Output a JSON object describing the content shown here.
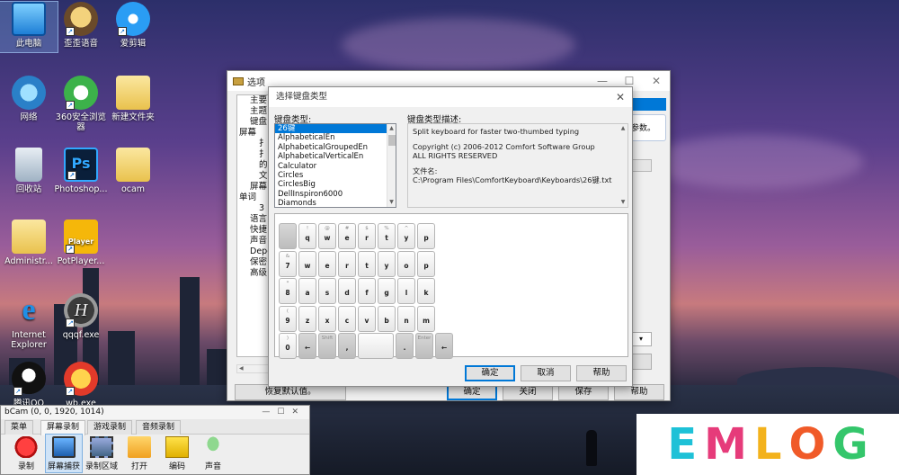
{
  "desktop": {
    "icons": [
      {
        "label": "此电脑"
      },
      {
        "label": "歪歪语音"
      },
      {
        "label": "爱剪辑"
      },
      {
        "label": "网络"
      },
      {
        "label": "360安全浏览器"
      },
      {
        "label": "新建文件夹"
      },
      {
        "label": "回收站"
      },
      {
        "label": "Photoshop..."
      },
      {
        "label": "ocam"
      },
      {
        "label": "Administr..."
      },
      {
        "label": "PotPlayer..."
      },
      {
        "label": "Internet Explorer"
      },
      {
        "label": "qqqf.exe"
      },
      {
        "label": "腾讯QQ"
      },
      {
        "label": "wb.exe"
      }
    ]
  },
  "options_window": {
    "title": "选项",
    "tree_items": [
      "主要",
      "主题",
      "键盘",
      "屏幕",
      "扌",
      "扌",
      "的",
      "文",
      "屏幕",
      "单词",
      "3",
      "语言",
      "快捷",
      "声音",
      "Depe",
      "保密",
      "高级"
    ],
    "right_text": "参数。",
    "buttons": {
      "reset": "恢复默认值。",
      "ok": "确定",
      "close": "关闭",
      "save": "保存",
      "help": "帮助"
    }
  },
  "keyboard_dialog": {
    "title": "选择键盘类型",
    "list_label": "键盘类型:",
    "list_items": [
      "26键",
      "AlphabeticalEn",
      "AlphabeticalGroupedEn",
      "AlphabeticalVerticalEn",
      "Calculator",
      "Circles",
      "CirclesBig",
      "DellInspiron6000",
      "Diamonds"
    ],
    "selected_index": 0,
    "desc_label": "键盘类型描述:",
    "desc_lines": [
      "Split keyboard for faster two-thumbed typing",
      "",
      "Copyright (c) 2006-2012  Comfort Software Group",
      "ALL RIGHTS RESERVED",
      "",
      "文件名:",
      "C:\\Program Files\\ComfortKeyboard\\Keyboards\\26键.txt"
    ],
    "buttons": {
      "ok": "确定",
      "cancel": "取消",
      "help": "帮助"
    },
    "keys": [
      [
        {
          "s": "",
          "m": "",
          "g": true
        },
        {
          "s": "!",
          "m": "q"
        },
        {
          "s": "@",
          "m": "w"
        },
        {
          "s": "#",
          "m": "e"
        },
        {
          "s": "$",
          "m": "r"
        },
        {
          "s": "%",
          "m": "t"
        },
        {
          "s": "^",
          "m": "y"
        },
        {
          "s": "",
          "m": "p"
        }
      ],
      [
        {
          "s": "&",
          "m": "7"
        },
        {
          "s": "",
          "m": "w"
        },
        {
          "s": "",
          "m": "e"
        },
        {
          "s": "",
          "m": "r"
        },
        {
          "s": "",
          "m": "t"
        },
        {
          "s": "",
          "m": "y"
        },
        {
          "s": "",
          "m": "o"
        },
        {
          "s": "",
          "m": "p"
        }
      ],
      [
        {
          "s": "*",
          "m": "8"
        },
        {
          "s": "",
          "m": "a"
        },
        {
          "s": "",
          "m": "s"
        },
        {
          "s": "",
          "m": "d"
        },
        {
          "s": "",
          "m": "f"
        },
        {
          "s": "",
          "m": "g"
        },
        {
          "s": "",
          "m": "l"
        },
        {
          "s": "",
          "m": "k"
        }
      ],
      [
        {
          "s": "(",
          "m": "9"
        },
        {
          "s": "",
          "m": "z"
        },
        {
          "s": "",
          "m": "x"
        },
        {
          "s": "",
          "m": "c"
        },
        {
          "s": "",
          "m": "v"
        },
        {
          "s": "",
          "m": "b"
        },
        {
          "s": "",
          "m": "n"
        },
        {
          "s": "",
          "m": "m"
        }
      ],
      [
        {
          "s": ")",
          "m": "0"
        },
        {
          "s": "",
          "m": "←",
          "g": true
        },
        {
          "s": "Shift",
          "m": "",
          "g": true
        },
        {
          "s": "",
          "m": ",",
          "g": true
        },
        {
          "s": "",
          "m": ""
        },
        {
          "s": "",
          "m": ".",
          "g": true
        },
        {
          "s": "Enter",
          "m": "",
          "g": true
        },
        {
          "s": "",
          "m": "←",
          "g": true
        }
      ]
    ]
  },
  "ocam": {
    "title": "bCam (0, 0, 1920, 1014)",
    "tabs": [
      "菜单",
      "屏幕录制",
      "游戏录制",
      "音频录制"
    ],
    "active_tab": 1,
    "tools": [
      {
        "label": "录制",
        "icon": "record-icon"
      },
      {
        "label": "屏幕捕获",
        "icon": "screen-capture-icon"
      },
      {
        "label": "录制区域",
        "icon": "record-area-icon"
      },
      {
        "label": "打开",
        "icon": "folder-icon"
      },
      {
        "label": "编码",
        "icon": "codec-icon"
      },
      {
        "label": "声音",
        "icon": "microphone-icon"
      }
    ]
  },
  "watermark": {
    "letters": [
      {
        "ch": "E",
        "color": "#1ec1d7"
      },
      {
        "ch": "M",
        "color": "#e63b7a"
      },
      {
        "ch": "L",
        "color": "#f3b21c"
      },
      {
        "ch": "O",
        "color": "#f05a28"
      },
      {
        "ch": "G",
        "color": "#34c66b"
      }
    ]
  }
}
